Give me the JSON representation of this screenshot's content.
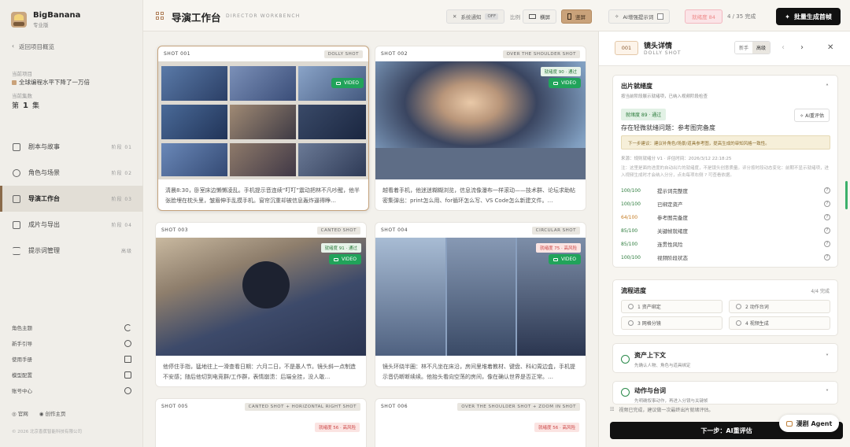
{
  "brand": {
    "name": "BigBanana",
    "edition": "专业版"
  },
  "sidebar": {
    "back_label": "返回项目概览",
    "project_caption": "当前项目",
    "project_name": "全球编程水平下降了一万倍",
    "episode_caption": "当前集数",
    "episode_prefix": "第",
    "episode_number": "1",
    "episode_suffix": "集",
    "nav": [
      {
        "label": "剧本与故事",
        "step": "阶段 01"
      },
      {
        "label": "角色与场景",
        "step": "阶段 02"
      },
      {
        "label": "导演工作台",
        "step": "阶段 03"
      },
      {
        "label": "成片与导出",
        "step": "阶段 04"
      },
      {
        "label": "提示词管理",
        "step": "高级"
      }
    ],
    "utilities": [
      {
        "label": "角色主题",
        "icon": "moon-icon"
      },
      {
        "label": "新手引导",
        "icon": "help-icon"
      },
      {
        "label": "使用手册",
        "icon": "book-icon"
      },
      {
        "label": "模型配置",
        "icon": "cube-icon"
      },
      {
        "label": "账号中心",
        "icon": "user-icon"
      }
    ],
    "footer_links": [
      "官网",
      "创作主页"
    ],
    "copyright": "© 2026 北京香蕉智能科技有限公司"
  },
  "topbar": {
    "title": "导演工作台",
    "subtitle": "DIRECTOR WORKBENCH",
    "notice_label": "系统通知",
    "notice_state": "OFF",
    "ratio_label": "比例",
    "landscape_label": "横屏",
    "portrait_label": "竖屏",
    "ai_word_label": "AI增强提示词",
    "ready_badge": "就绪度 84",
    "progress": "4 / 35 完成",
    "batch_button": "批量生成首帧"
  },
  "shots": [
    {
      "id": "SHOT 001",
      "tag": "DOLLY SHOT",
      "badge": "",
      "video": "VIDEO",
      "desc": "清晨8:30，卧室床边懒懒凌乱。手机提示音连续“叮叮”震动把林不凡吵醒，他半张脸埋在枕头里，皱眉伸手乱摸手机。窗帘沉重却被信息轰炸逼得睁…"
    },
    {
      "id": "SHOT 002",
      "tag": "OVER THE SHOULDER SHOT",
      "badge": "就绪度 90 · 通过",
      "video": "VIDEO",
      "desc": "越看着手机，他迷迷糊糊浏览，信息流像瀑布一样滚动——技术群、论坛求助帖密集弹出：print怎么用、for循环怎么写、VS Code怎么新建文件。…"
    },
    {
      "id": "SHOT 003",
      "tag": "CANTED SHOT",
      "badge": "就绪度 91 · 通过",
      "video": "VIDEO",
      "desc": "他停住手指，猛地往上一滑查看日期：六月二日，不是愚人节。镜头斜一点制造不安感；随后他切到电竞群/工作群，表情崩溃：后端全挂，没人敢…"
    },
    {
      "id": "SHOT 004",
      "tag": "CIRCULAR SHOT",
      "badge": "就绪度 75 · 高风险",
      "video": "VIDEO",
      "desc": "镜头环绕半圈：林不凡坐在床沿，房间里堆着教材、键盘、科幻周边盒，手机提示音仍断断续续。他抬头看向空荡的房间，像在确认世界是否正常。…"
    },
    {
      "id": "SHOT 005",
      "tag": "CANTED SHOT + HORIZONTAL RIGHT SHOT",
      "badge": "就绪度 56 · 高风险",
      "video": "",
      "desc": ""
    },
    {
      "id": "SHOT 006",
      "tag": "OVER THE SHOULDER SHOT + ZOOM IN SHOT",
      "badge": "就绪度 56 · 高风险",
      "video": "",
      "desc": ""
    }
  ],
  "panel": {
    "shot_no": "001",
    "title": "镜头详情",
    "subtitle": "DOLLY SHOT",
    "mode_simple": "新手",
    "mode_advanced": "高级",
    "readiness": {
      "title": "出片就绪度",
      "subtitle": "按当前阶段展示就绪项，已纳入视频阶段检查",
      "tag": "就绪度 89 · 通过",
      "reeval": "AI重评估",
      "issue": "存在轻微就绪问题：参考图完备度",
      "next_hint": "下一步建议：建议补角色/场景/道具参考图，提高生成的审知风格一致性。",
      "meta": "来源：规则就绪分 V1 · 评估时间：2026/3/12 22:18:25",
      "note": "注：这里是面的进度的自动出片的就绪度，不是镜头创意质量。评分按时段动态变化：前期不显示就绪项，进入视频生成时才会纳入分分，点击每项右侧 ? 可查看依据。",
      "items": [
        {
          "score": "100/100",
          "label": "提示词完整度"
        },
        {
          "score": "100/100",
          "label": "已绑定资产"
        },
        {
          "score": "64/100",
          "label": "参考图完备度"
        },
        {
          "score": "85/100",
          "label": "关键帧就绪度"
        },
        {
          "score": "85/100",
          "label": "连贯性风险"
        },
        {
          "score": "100/100",
          "label": "视频阶段状态"
        }
      ]
    },
    "flow": {
      "title": "流程进度",
      "count": "4/4 完成",
      "steps": [
        "1 资产绑定",
        "2 动作台词",
        "3 网格分镜",
        "4 视频生成"
      ]
    },
    "assets": {
      "title": "资产上下文",
      "subtitle": "先确认人物、角色与道具绑定"
    },
    "action": {
      "title": "动作与台词",
      "subtitle": "先明确叙事动作，再进入分镜与关键帧"
    },
    "tip": "视频已完成，建议做一次最终出片就绪评估。",
    "next_button": "下一步：AI重评估"
  },
  "agent_label": "漫剧 Agent",
  "colors": {
    "accent": "#c9a27a",
    "ok": "#2a7a3a",
    "warn": "#c44",
    "dark": "#111111"
  }
}
